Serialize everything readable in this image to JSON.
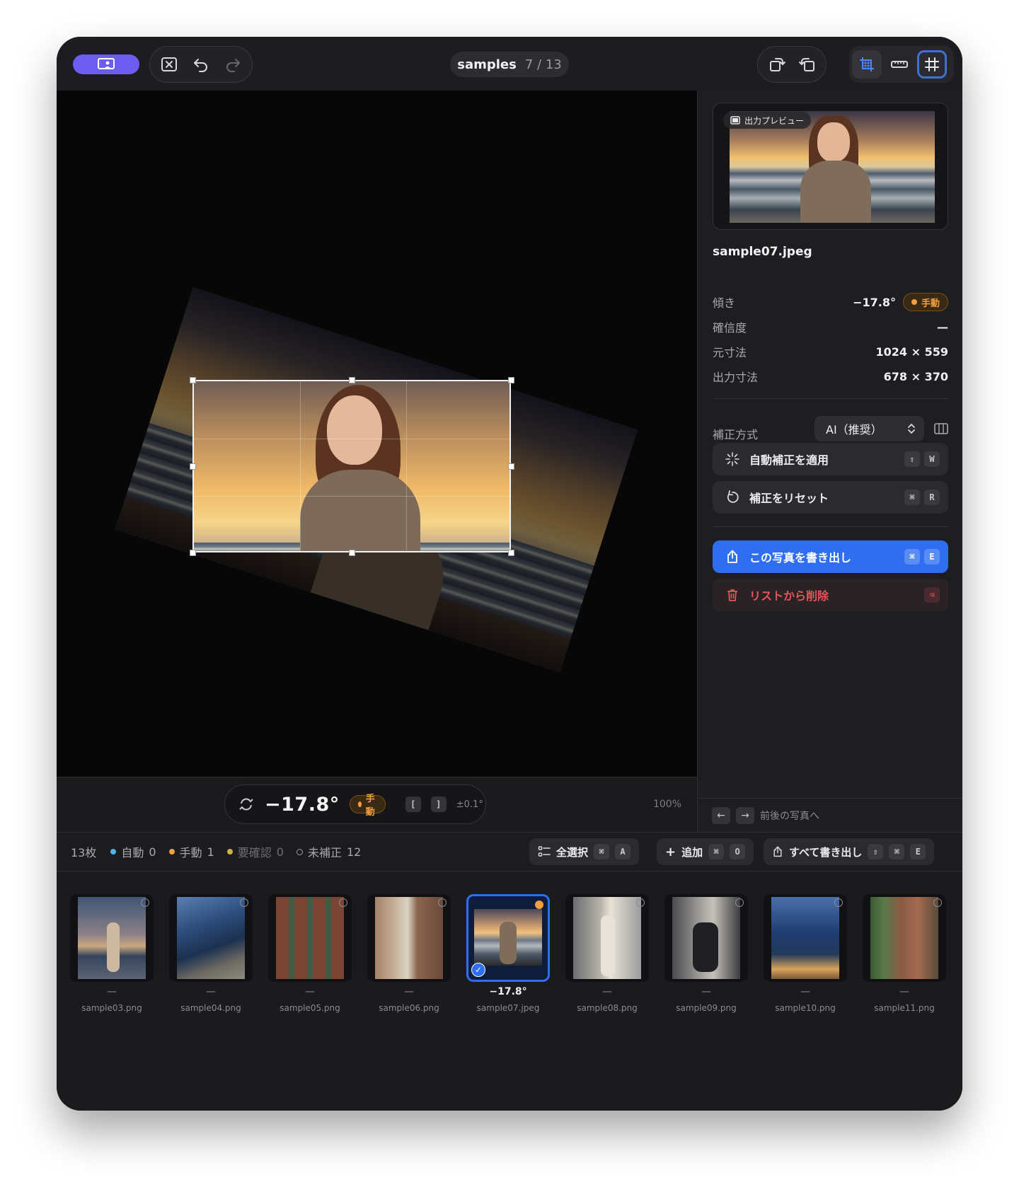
{
  "toolbar": {
    "title": "samples",
    "position": "7 / 13",
    "icons": [
      "app-icon",
      "close-image-icon",
      "undo-icon",
      "redo-icon",
      "rotate-left-icon",
      "rotate-right-icon",
      "crop-grid-icon",
      "ruler-icon",
      "grid-icon"
    ]
  },
  "canvas": {
    "angle": "−17.8°",
    "mode_badge": "手動",
    "key_left": "[",
    "key_right": "]",
    "step": "±0.1°",
    "zoom": "100%"
  },
  "panel": {
    "preview_label": "出力プレビュー",
    "filename": "sample07.jpeg",
    "props": [
      {
        "key": "傾き",
        "value": "−17.8°",
        "badge": "手動"
      },
      {
        "key": "確信度",
        "value": "—"
      },
      {
        "key": "元寸法",
        "value": "1024 × 559"
      },
      {
        "key": "出力寸法",
        "value": "678 × 370"
      }
    ],
    "method_label": "補正方式",
    "method_value": "AI（推奨）",
    "auto_apply": {
      "label": "自動補正を適用",
      "keys": [
        "⇧",
        "W"
      ]
    },
    "reset": {
      "label": "補正をリセット",
      "keys": [
        "⌘",
        "R"
      ]
    },
    "export_one": {
      "label": "この写真を書き出し",
      "keys": [
        "⌘",
        "E"
      ]
    },
    "remove": {
      "label": "リストから削除",
      "keys": [
        "⌫"
      ]
    },
    "nav_hint": "前後の写真へ"
  },
  "statusbar": {
    "total": "13枚",
    "auto_label": "自動",
    "auto_count": "0",
    "manual_label": "手動",
    "manual_count": "1",
    "review_label": "要確認",
    "review_count": "0",
    "uncorrected_label": "未補正",
    "uncorrected_count": "12",
    "select_all": {
      "label": "全選択",
      "keys": [
        "⌘",
        "A"
      ]
    },
    "add": {
      "label": "追加",
      "keys": [
        "⌘",
        "O"
      ]
    },
    "export_all": {
      "label": "すべて書き出し",
      "keys": [
        "⇧",
        "⌘",
        "E"
      ]
    }
  },
  "colors": {
    "accent": "#2f6ef0",
    "app_button": "#6c5cf0",
    "manual": "#f0a040",
    "auto": "#4fb6e8",
    "review": "#d0b040",
    "danger": "#e8545a"
  },
  "thumbnails": [
    {
      "name": "sample03.png",
      "angle": "—",
      "selected": false
    },
    {
      "name": "sample04.png",
      "angle": "—",
      "selected": false
    },
    {
      "name": "sample05.png",
      "angle": "—",
      "selected": false
    },
    {
      "name": "sample06.png",
      "angle": "—",
      "selected": false
    },
    {
      "name": "sample07.jpeg",
      "angle": "−17.8°",
      "selected": true
    },
    {
      "name": "sample08.png",
      "angle": "—",
      "selected": false
    },
    {
      "name": "sample09.png",
      "angle": "—",
      "selected": false
    },
    {
      "name": "sample10.png",
      "angle": "—",
      "selected": false
    },
    {
      "name": "sample11.png",
      "angle": "—",
      "selected": false
    }
  ]
}
